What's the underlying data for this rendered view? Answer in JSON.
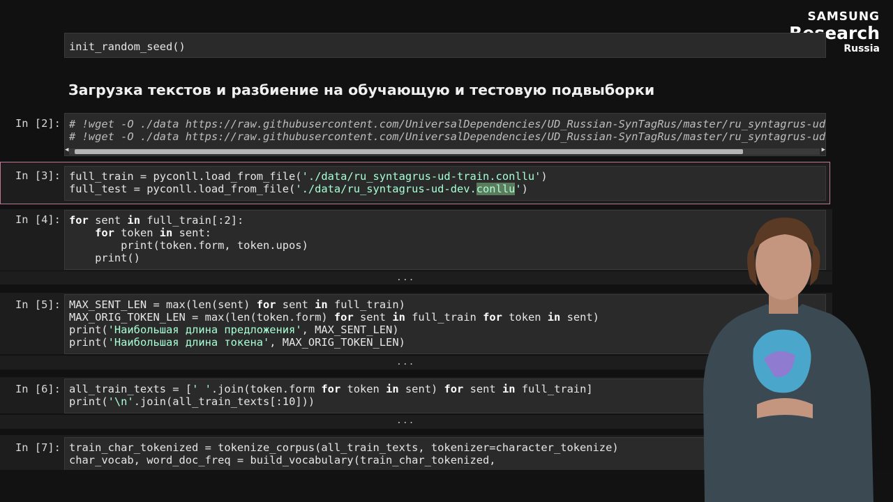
{
  "logo": {
    "line1": "SAMSUNG",
    "line2": "Research",
    "line3": "Russia"
  },
  "heading": "Загрузка текстов и разбиение на обучающую и тестовую подвыборки",
  "cells": {
    "c1": {
      "lines": [
        "init_random_seed()"
      ]
    },
    "c2": {
      "prompt": "In [2]:",
      "lines": [
        "# !wget -O ./data https://raw.githubusercontent.com/UniversalDependencies/UD_Russian-SynTagRus/master/ru_syntagrus-ud-",
        "# !wget -O ./data https://raw.githubusercontent.com/UniversalDependencies/UD_Russian-SynTagRus/master/ru_syntagrus-ud-"
      ]
    },
    "c3": {
      "prompt": "In [3]:",
      "l1a": "full_train = pyconll.load_from_file(",
      "l1s": "'./data/ru_syntagrus-ud-train.conllu'",
      "l1b": ")",
      "l2a": "full_test = pyconll.load_from_file(",
      "l2s1": "'./data/ru_syntagrus-ud-dev.",
      "l2sel": "conllu",
      "l2s2": "'",
      "l2b": ")"
    },
    "c4": {
      "prompt": "In [4]:",
      "dots": "..."
    },
    "c5": {
      "prompt": "In [5]:",
      "dots": "...",
      "s1": "'Наибольшая длина предложения'",
      "s2": "'Наибольшая длина токена'"
    },
    "c6": {
      "prompt": "In [6]:",
      "dots": "...",
      "s1": "' '",
      "s2": "'\\n'"
    },
    "c7": {
      "prompt": "In [7]:"
    }
  }
}
